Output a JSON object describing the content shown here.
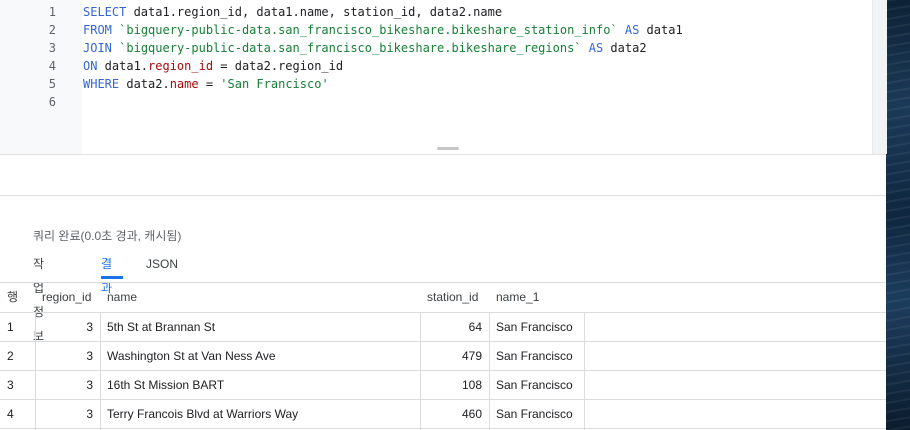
{
  "editor": {
    "line_numbers": [
      "1",
      "2",
      "3",
      "4",
      "5",
      "6"
    ],
    "lines": [
      [
        {
          "t": "SELECT",
          "c": "kw"
        },
        {
          "t": " data1.region_id, data1.name, station_id, data2.name",
          "c": ""
        }
      ],
      [
        {
          "t": "FROM",
          "c": "kw"
        },
        {
          "t": " ",
          "c": ""
        },
        {
          "t": "`bigquery-public-data.san_francisco_bikeshare.bikeshare_station_info`",
          "c": "str"
        },
        {
          "t": " ",
          "c": ""
        },
        {
          "t": "AS",
          "c": "kw"
        },
        {
          "t": " data1",
          "c": ""
        }
      ],
      [
        {
          "t": "JOIN",
          "c": "kw"
        },
        {
          "t": " ",
          "c": ""
        },
        {
          "t": "`bigquery-public-data.san_francisco_bikeshare.bikeshare_regions`",
          "c": "str"
        },
        {
          "t": " ",
          "c": ""
        },
        {
          "t": "AS",
          "c": "kw"
        },
        {
          "t": " data2",
          "c": ""
        }
      ],
      [
        {
          "t": "ON",
          "c": "kw"
        },
        {
          "t": " data1.",
          "c": ""
        },
        {
          "t": "region_id",
          "c": "fld"
        },
        {
          "t": " = data2.region_id",
          "c": ""
        }
      ],
      [
        {
          "t": "WHERE",
          "c": "kw"
        },
        {
          "t": " data2.",
          "c": ""
        },
        {
          "t": "name",
          "c": "fld"
        },
        {
          "t": " = ",
          "c": ""
        },
        {
          "t": "'San Francisco'",
          "c": "str"
        }
      ],
      []
    ]
  },
  "results": {
    "status": "쿼리 완료(0.0초 경과, 캐시됨)",
    "tabs": [
      {
        "label": "작업 정보",
        "active": false
      },
      {
        "label": "결과",
        "active": true
      },
      {
        "label": "JSON",
        "active": false
      }
    ],
    "columns": [
      "행",
      "region_id",
      "name",
      "station_id",
      "name_1"
    ],
    "rows": [
      [
        "1",
        "3",
        "5th St at Brannan St",
        "64",
        "San Francisco"
      ],
      [
        "2",
        "3",
        "Washington St at Van Ness Ave",
        "479",
        "San Francisco"
      ],
      [
        "3",
        "3",
        "16th St Mission BART",
        "108",
        "San Francisco"
      ],
      [
        "4",
        "3",
        "Terry Francois Blvd at Warriors Way",
        "460",
        "San Francisco"
      ]
    ]
  },
  "colors": {
    "keyword": "#3367d6",
    "string": "#188038",
    "field": "#a50e0e",
    "tab_active": "#1a73e8"
  }
}
